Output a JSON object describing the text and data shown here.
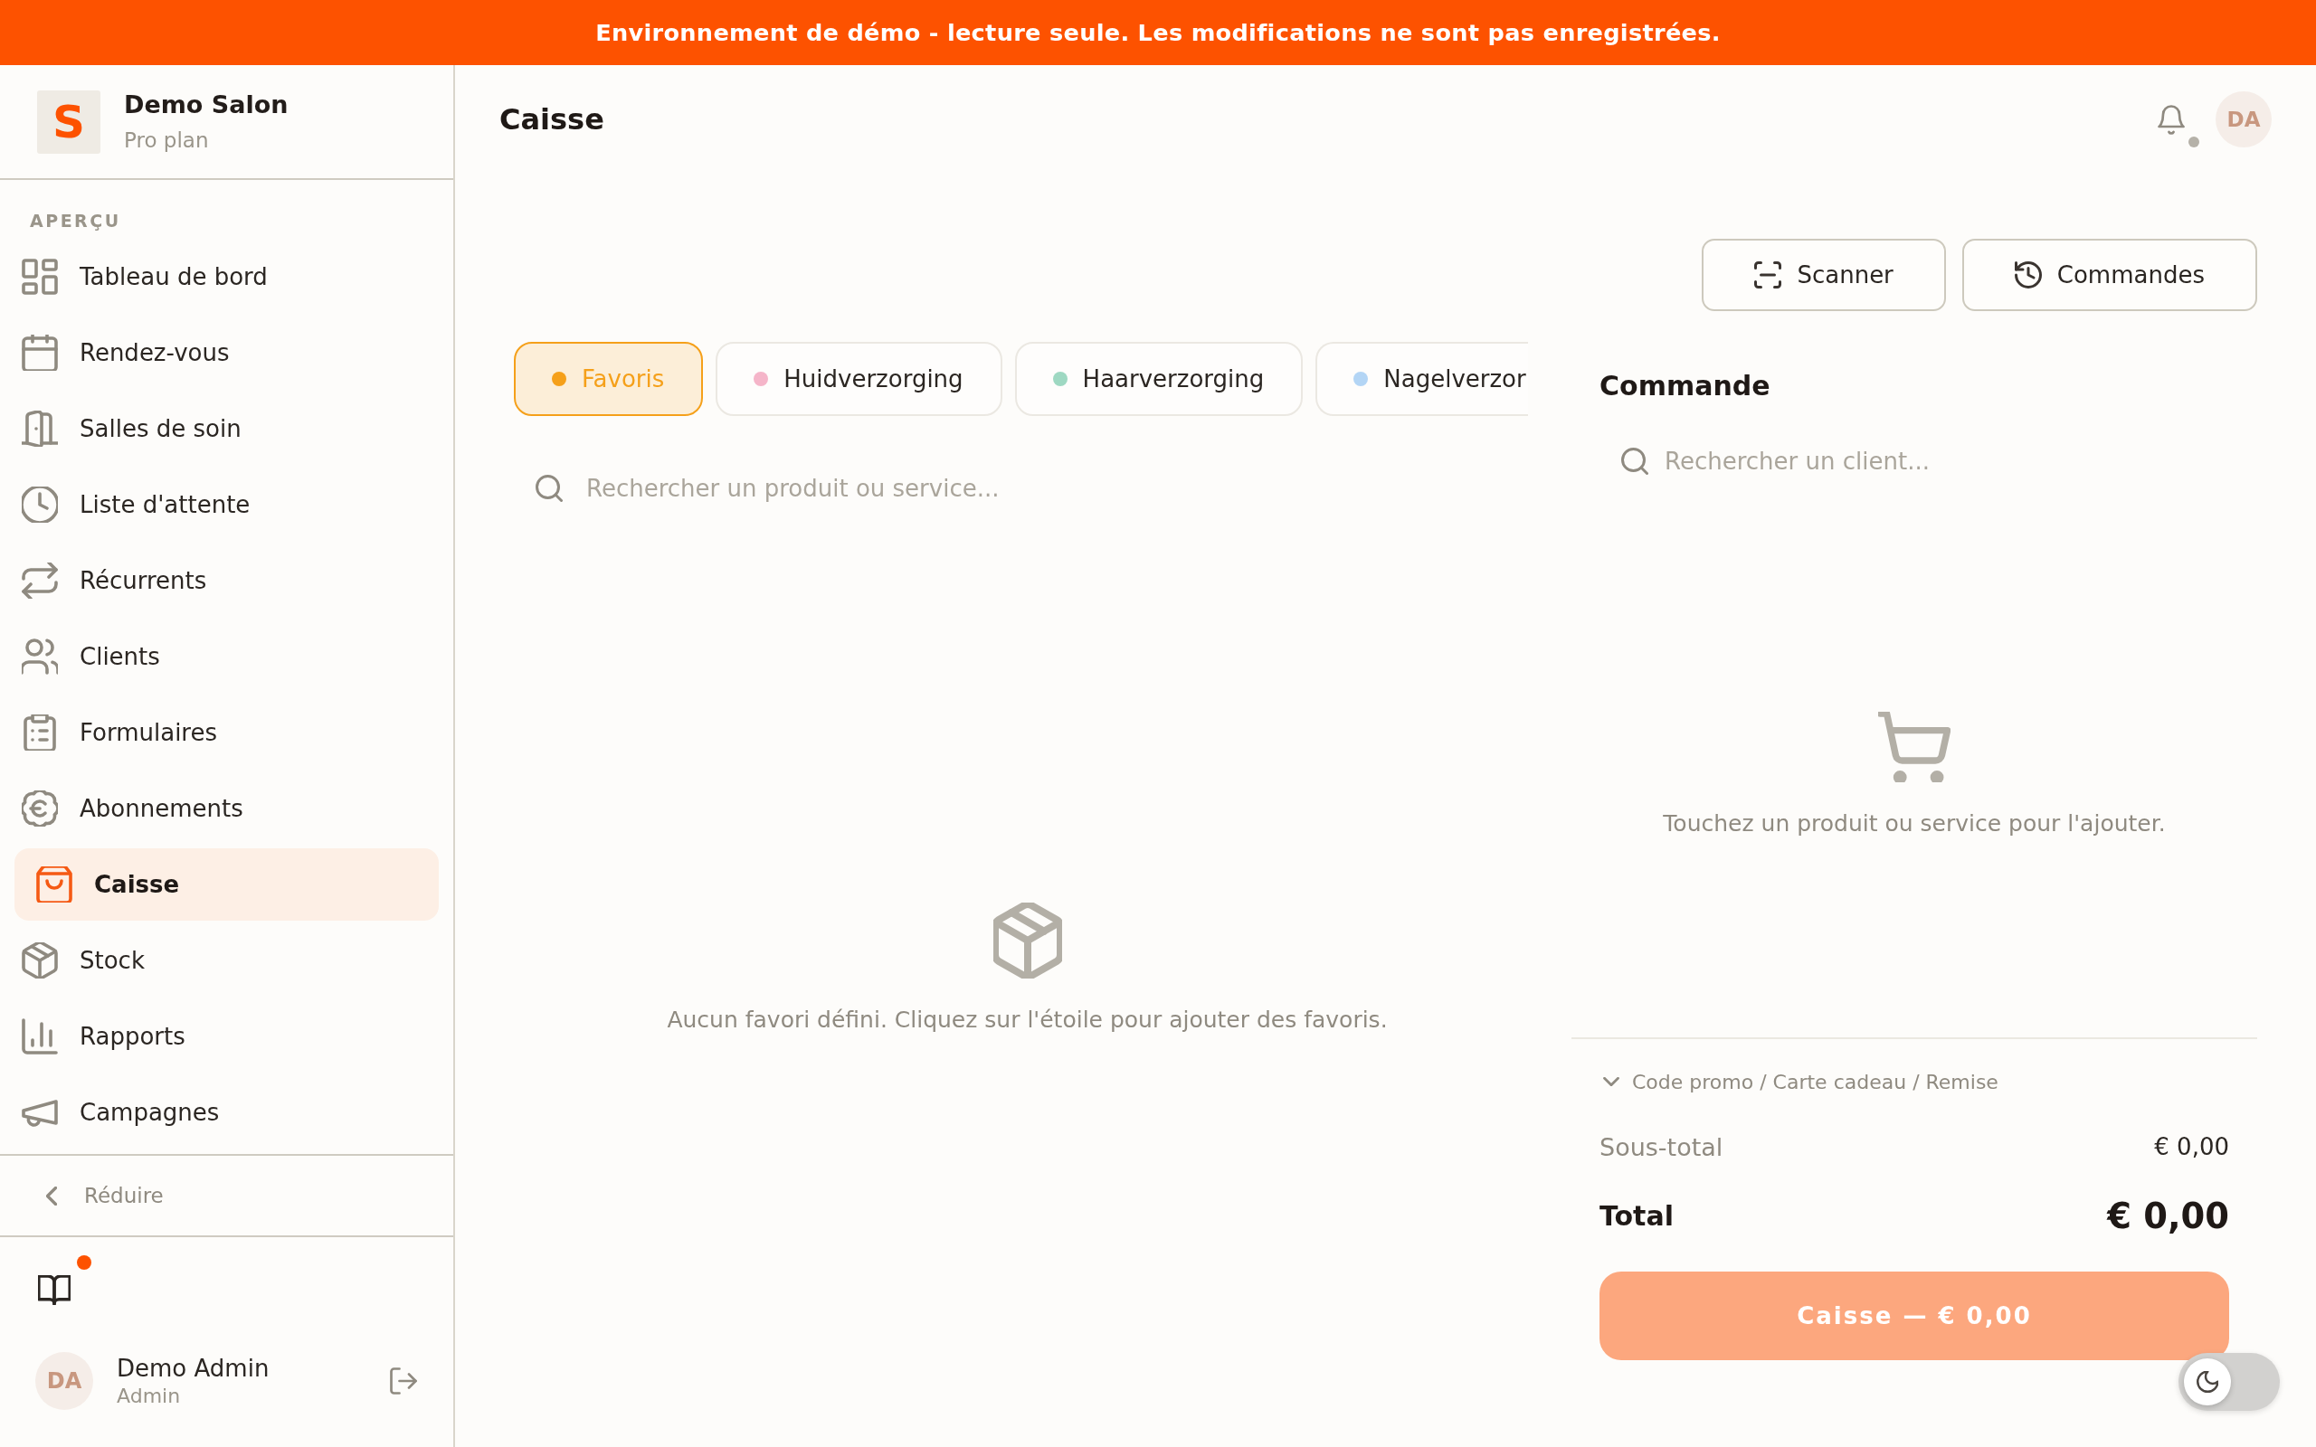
{
  "demo_banner": {
    "text": "Environnement de démo - lecture seule. Les modifications ne sont pas enregistrées."
  },
  "sidebar": {
    "brand": {
      "logo_letter": "S",
      "name": "Demo Salon",
      "plan": "Pro plan"
    },
    "section_label": "APERÇU",
    "items": [
      {
        "label": "Tableau de bord",
        "selected": false
      },
      {
        "label": "Rendez-vous",
        "selected": false
      },
      {
        "label": "Salles de soin",
        "selected": false
      },
      {
        "label": "Liste d'attente",
        "selected": false
      },
      {
        "label": "Récurrents",
        "selected": false
      },
      {
        "label": "Clients",
        "selected": false
      },
      {
        "label": "Formulaires",
        "selected": false
      },
      {
        "label": "Abonnements",
        "selected": false
      },
      {
        "label": "Caisse",
        "selected": true
      },
      {
        "label": "Stock",
        "selected": false
      },
      {
        "label": "Rapports",
        "selected": false
      },
      {
        "label": "Campagnes",
        "selected": false
      }
    ],
    "collapse_label": "Réduire",
    "guide": {
      "unread": true
    },
    "user": {
      "initials": "DA",
      "name": "Demo Admin",
      "role": "Admin"
    }
  },
  "header": {
    "title": "Caisse",
    "notifications": {
      "indicator": true
    },
    "avatar_initials": "DA"
  },
  "actions": [
    {
      "label": "Scanner"
    },
    {
      "label": "Commandes"
    }
  ],
  "categories": [
    {
      "label": "Favoris",
      "color": "#f5a01a",
      "selected": true
    },
    {
      "label": "Huidverzorging",
      "color": "#f5b5c9",
      "selected": false
    },
    {
      "label": "Haarverzorging",
      "color": "#9ed8c2",
      "selected": false
    },
    {
      "label": "Nagelverzor",
      "color": "#b3d5f5",
      "selected": false
    }
  ],
  "product_search": {
    "placeholder": "Rechercher un produit ou service..."
  },
  "products_empty_message": "Aucun favori défini. Cliquez sur l'étoile pour ajouter des favoris.",
  "order": {
    "title": "Commande",
    "client_search": {
      "placeholder": "Rechercher un client..."
    },
    "empty_message": "Touchez un produit ou service pour l'ajouter.",
    "discount": {
      "label": "Code promo / Carte cadeau / Remise",
      "expanded": false
    },
    "subtotal": {
      "label": "Sous-total",
      "value": "€ 0,00"
    },
    "total": {
      "label": "Total",
      "value": "€ 0,00"
    },
    "checkout_button": {
      "label": "Caisse — € 0,00",
      "disabled": true
    }
  },
  "theme_toggle": {
    "on": false
  }
}
